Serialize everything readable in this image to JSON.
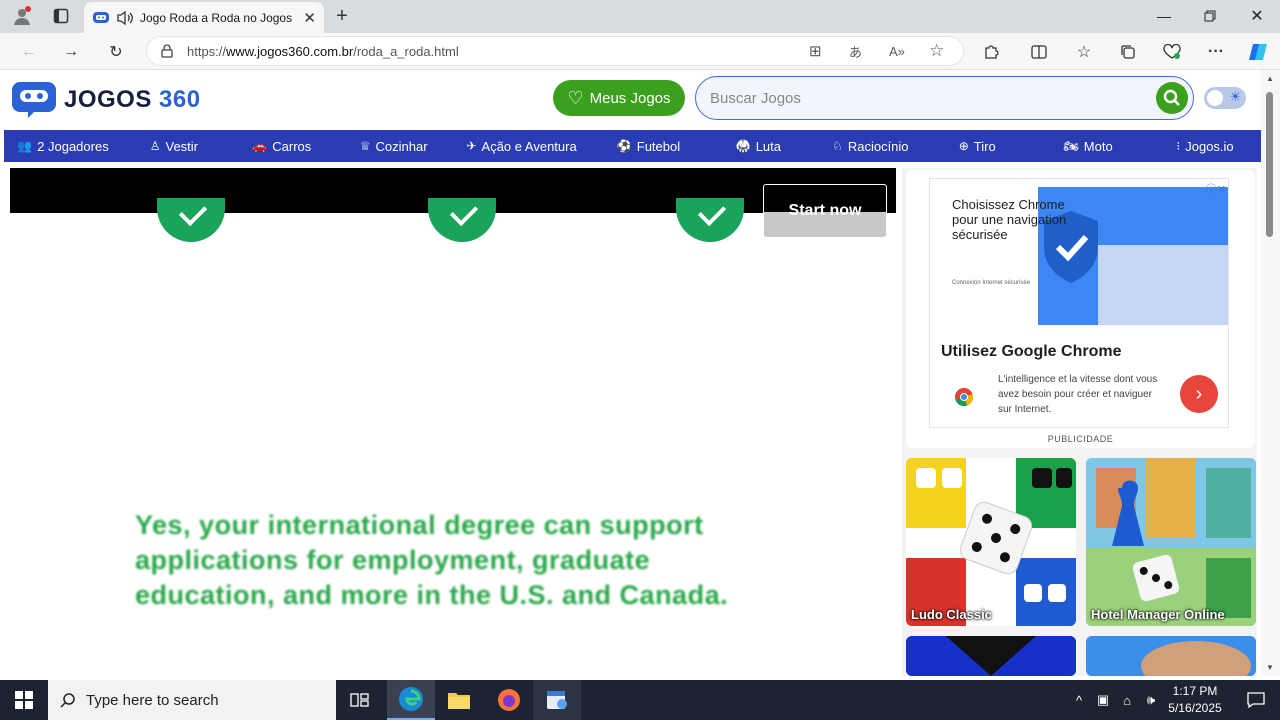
{
  "browser": {
    "tab_title": "Jogo Roda a Roda no Jogos",
    "url_prefix": "https://",
    "url_domain": "www.jogos360.com.br",
    "url_path": "/roda_a_roda.html"
  },
  "header": {
    "logo_main": "JOGOS",
    "logo_num": "360",
    "my_games_label": "Meus Jogos",
    "search_placeholder": "Buscar Jogos"
  },
  "nav": {
    "items": [
      {
        "label": "2 Jogadores",
        "icon": "users-icon"
      },
      {
        "label": "Vestir",
        "icon": "dress-icon"
      },
      {
        "label": "Carros",
        "icon": "car-icon"
      },
      {
        "label": "Cozinhar",
        "icon": "chef-hat-icon"
      },
      {
        "label": "Ação e Aventura",
        "icon": "action-icon"
      },
      {
        "label": "Futebol",
        "icon": "soccer-ball-icon"
      },
      {
        "label": "Luta",
        "icon": "fighter-icon"
      },
      {
        "label": "Raciocínio",
        "icon": "brain-icon"
      },
      {
        "label": "Tiro",
        "icon": "crosshair-icon"
      },
      {
        "label": "Moto",
        "icon": "motorcycle-icon"
      },
      {
        "label": "Jogos.io",
        "icon": "io-icon"
      }
    ]
  },
  "game_ad": {
    "start_label": "Start now",
    "copy": "Yes, your international degree can support applications for employment, graduate education, and more in the U.S. and Canada."
  },
  "sidebar_ad": {
    "headline": "Choisissez Chrome pour une navigation sécurisée",
    "fine_print": "Connexion Internet sécurisée",
    "title": "Utilisez Google Chrome",
    "body": "L'intelligence et la vitesse dont vous avez besoin pour créer et naviguer sur Internet.",
    "label": "PUBLICIDADE",
    "colors": {
      "brand": "#3d87f5",
      "cta": "#e8453c"
    }
  },
  "games": [
    {
      "name": "Ludo Classic"
    },
    {
      "name": "Hotel Manager Online"
    }
  ],
  "taskbar": {
    "search_placeholder": "Type here to search",
    "time": "1:17 PM",
    "date": "5/16/2025"
  },
  "colors": {
    "accent_green": "#3ba01e",
    "nav_blue": "#2a3cb4",
    "logo_blue": "#2b62d6"
  }
}
